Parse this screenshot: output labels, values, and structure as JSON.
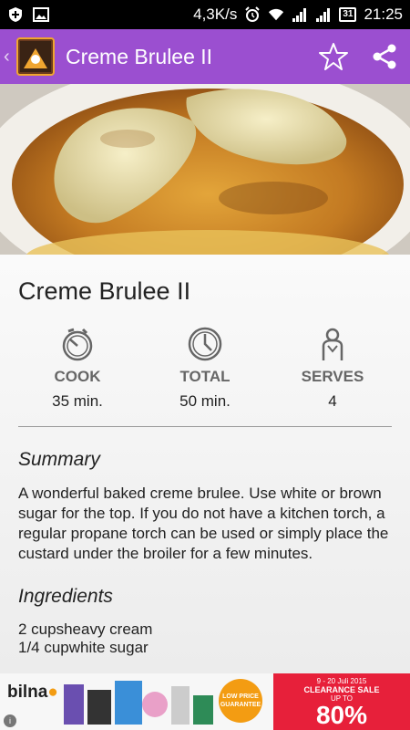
{
  "status_bar": {
    "speed": "4,3K/s",
    "calendar_day": "31",
    "time": "21:25"
  },
  "app_bar": {
    "title": "Creme Brulee II"
  },
  "recipe": {
    "title": "Creme Brulee II",
    "stats": [
      {
        "label": "COOK",
        "value": "35 min.",
        "icon": "stopwatch-icon"
      },
      {
        "label": "TOTAL",
        "value": "50 min.",
        "icon": "clock-icon"
      },
      {
        "label": "SERVES",
        "value": "4",
        "icon": "person-icon"
      }
    ],
    "summary_heading": "Summary",
    "summary_text": " A wonderful baked creme brulee. Use white or brown sugar for the top. If you do not have a kitchen torch, a regular propane torch can be used or simply place the custard under the broiler for a few minutes.",
    "ingredients_heading": "Ingredients",
    "ingredients": [
      "2 cupsheavy cream",
      "1/4 cupwhite sugar"
    ]
  },
  "ad": {
    "brand": "bilna",
    "badge": "LOW PRICE GUARANTEE",
    "dates": "9 - 20 Juli 2015",
    "sale": "CLEARANCE SALE",
    "upto": "UP TO",
    "percent": "80%"
  },
  "colors": {
    "app_bar": "#9b4fd0",
    "ad_red": "#e7203a"
  }
}
